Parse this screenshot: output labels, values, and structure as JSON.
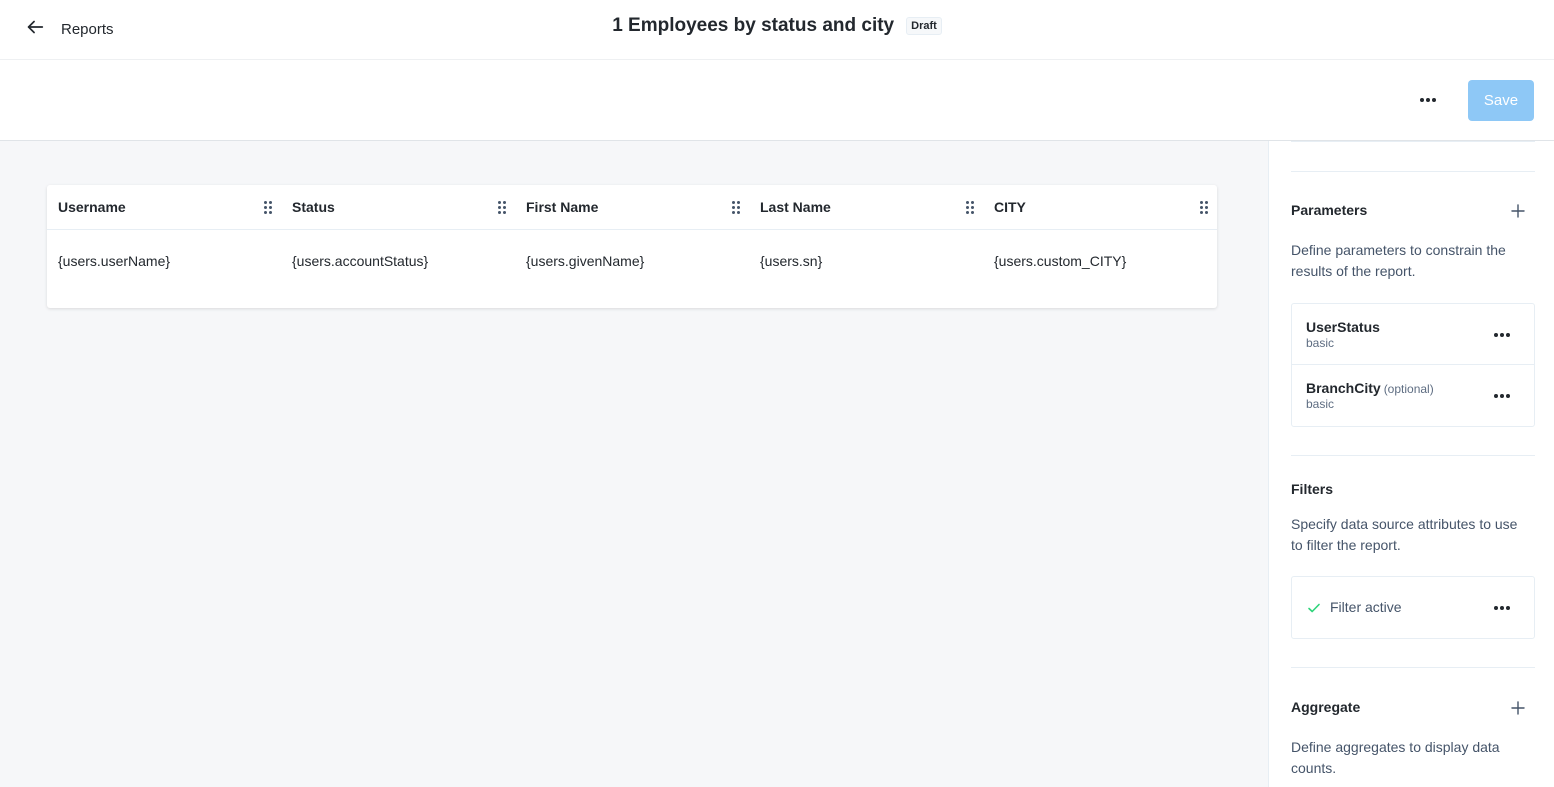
{
  "header": {
    "back_label": "Reports",
    "title": "1 Employees by status and city",
    "badge": "Draft"
  },
  "toolbar": {
    "save_label": "Save"
  },
  "table": {
    "columns": [
      "Username",
      "Status",
      "First Name",
      "Last Name",
      "CITY"
    ],
    "rows": [
      [
        "{users.userName}",
        "{users.accountStatus}",
        "{users.givenName}",
        "{users.sn}",
        "{users.custom_CITY}"
      ]
    ]
  },
  "panel": {
    "parameters": {
      "title": "Parameters",
      "description": "Define parameters to constrain the results of the report.",
      "items": [
        {
          "name": "UserStatus",
          "optional": "",
          "type": "basic"
        },
        {
          "name": "BranchCity",
          "optional": "(optional)",
          "type": "basic"
        }
      ]
    },
    "filters": {
      "title": "Filters",
      "description": "Specify data source attributes to use to filter the report.",
      "items": [
        {
          "label": "Filter active"
        }
      ]
    },
    "aggregate": {
      "title": "Aggregate",
      "description": "Define aggregates to display data counts."
    }
  },
  "colors": {
    "accent_save": "#8ec8f6",
    "check_green": "#2ed47a",
    "canvas_bg": "#f6f7f9"
  }
}
